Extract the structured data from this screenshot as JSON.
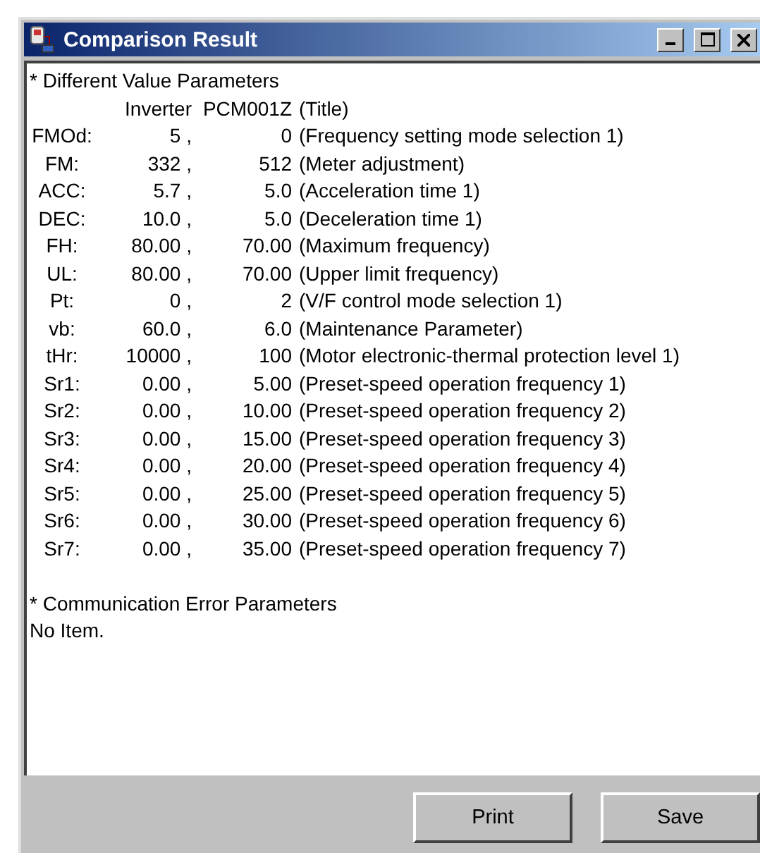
{
  "window": {
    "title": "Comparison Result"
  },
  "sections": [
    {
      "heading": "* Different Value Parameters",
      "header": {
        "inverter": "Inverter",
        "pc": "PCM001Z",
        "description": "(Title)"
      },
      "rows": [
        {
          "name": "FMOd:",
          "inverter": "5 ,",
          "pc": "0",
          "description": "(Frequency setting mode selection 1)"
        },
        {
          "name": "FM:",
          "inverter": "332 ,",
          "pc": "512",
          "description": "(Meter adjustment)"
        },
        {
          "name": "ACC:",
          "inverter": "5.7 ,",
          "pc": "5.0",
          "description": "(Acceleration time 1)"
        },
        {
          "name": "DEC:",
          "inverter": "10.0 ,",
          "pc": "5.0",
          "description": "(Deceleration time 1)"
        },
        {
          "name": "FH:",
          "inverter": "80.00 ,",
          "pc": "70.00",
          "description": "(Maximum frequency)"
        },
        {
          "name": "UL:",
          "inverter": "80.00 ,",
          "pc": "70.00",
          "description": "(Upper limit frequency)"
        },
        {
          "name": "Pt:",
          "inverter": "0 ,",
          "pc": "2",
          "description": "(V/F control mode selection 1)"
        },
        {
          "name": "vb:",
          "inverter": "60.0 ,",
          "pc": "6.0",
          "description": "(Maintenance Parameter)"
        },
        {
          "name": "tHr:",
          "inverter": "10000 ,",
          "pc": "100",
          "description": "(Motor electronic-thermal protection level 1)"
        },
        {
          "name": "Sr1:",
          "inverter": "0.00 ,",
          "pc": "5.00",
          "description": "(Preset-speed operation frequency 1)"
        },
        {
          "name": "Sr2:",
          "inverter": "0.00 ,",
          "pc": "10.00",
          "description": "(Preset-speed operation frequency 2)"
        },
        {
          "name": "Sr3:",
          "inverter": "0.00 ,",
          "pc": "15.00",
          "description": "(Preset-speed operation frequency 3)"
        },
        {
          "name": "Sr4:",
          "inverter": "0.00 ,",
          "pc": "20.00",
          "description": "(Preset-speed operation frequency 4)"
        },
        {
          "name": "Sr5:",
          "inverter": "0.00 ,",
          "pc": "25.00",
          "description": "(Preset-speed operation frequency 5)"
        },
        {
          "name": "Sr6:",
          "inverter": "0.00 ,",
          "pc": "30.00",
          "description": "(Preset-speed operation frequency 6)"
        },
        {
          "name": "Sr7:",
          "inverter": "0.00 ,",
          "pc": "35.00",
          "description": "(Preset-speed operation frequency 7)"
        }
      ]
    },
    {
      "heading": "* Communication Error Parameters",
      "note": "No Item."
    }
  ],
  "buttons": [
    "Print",
    "Save"
  ]
}
